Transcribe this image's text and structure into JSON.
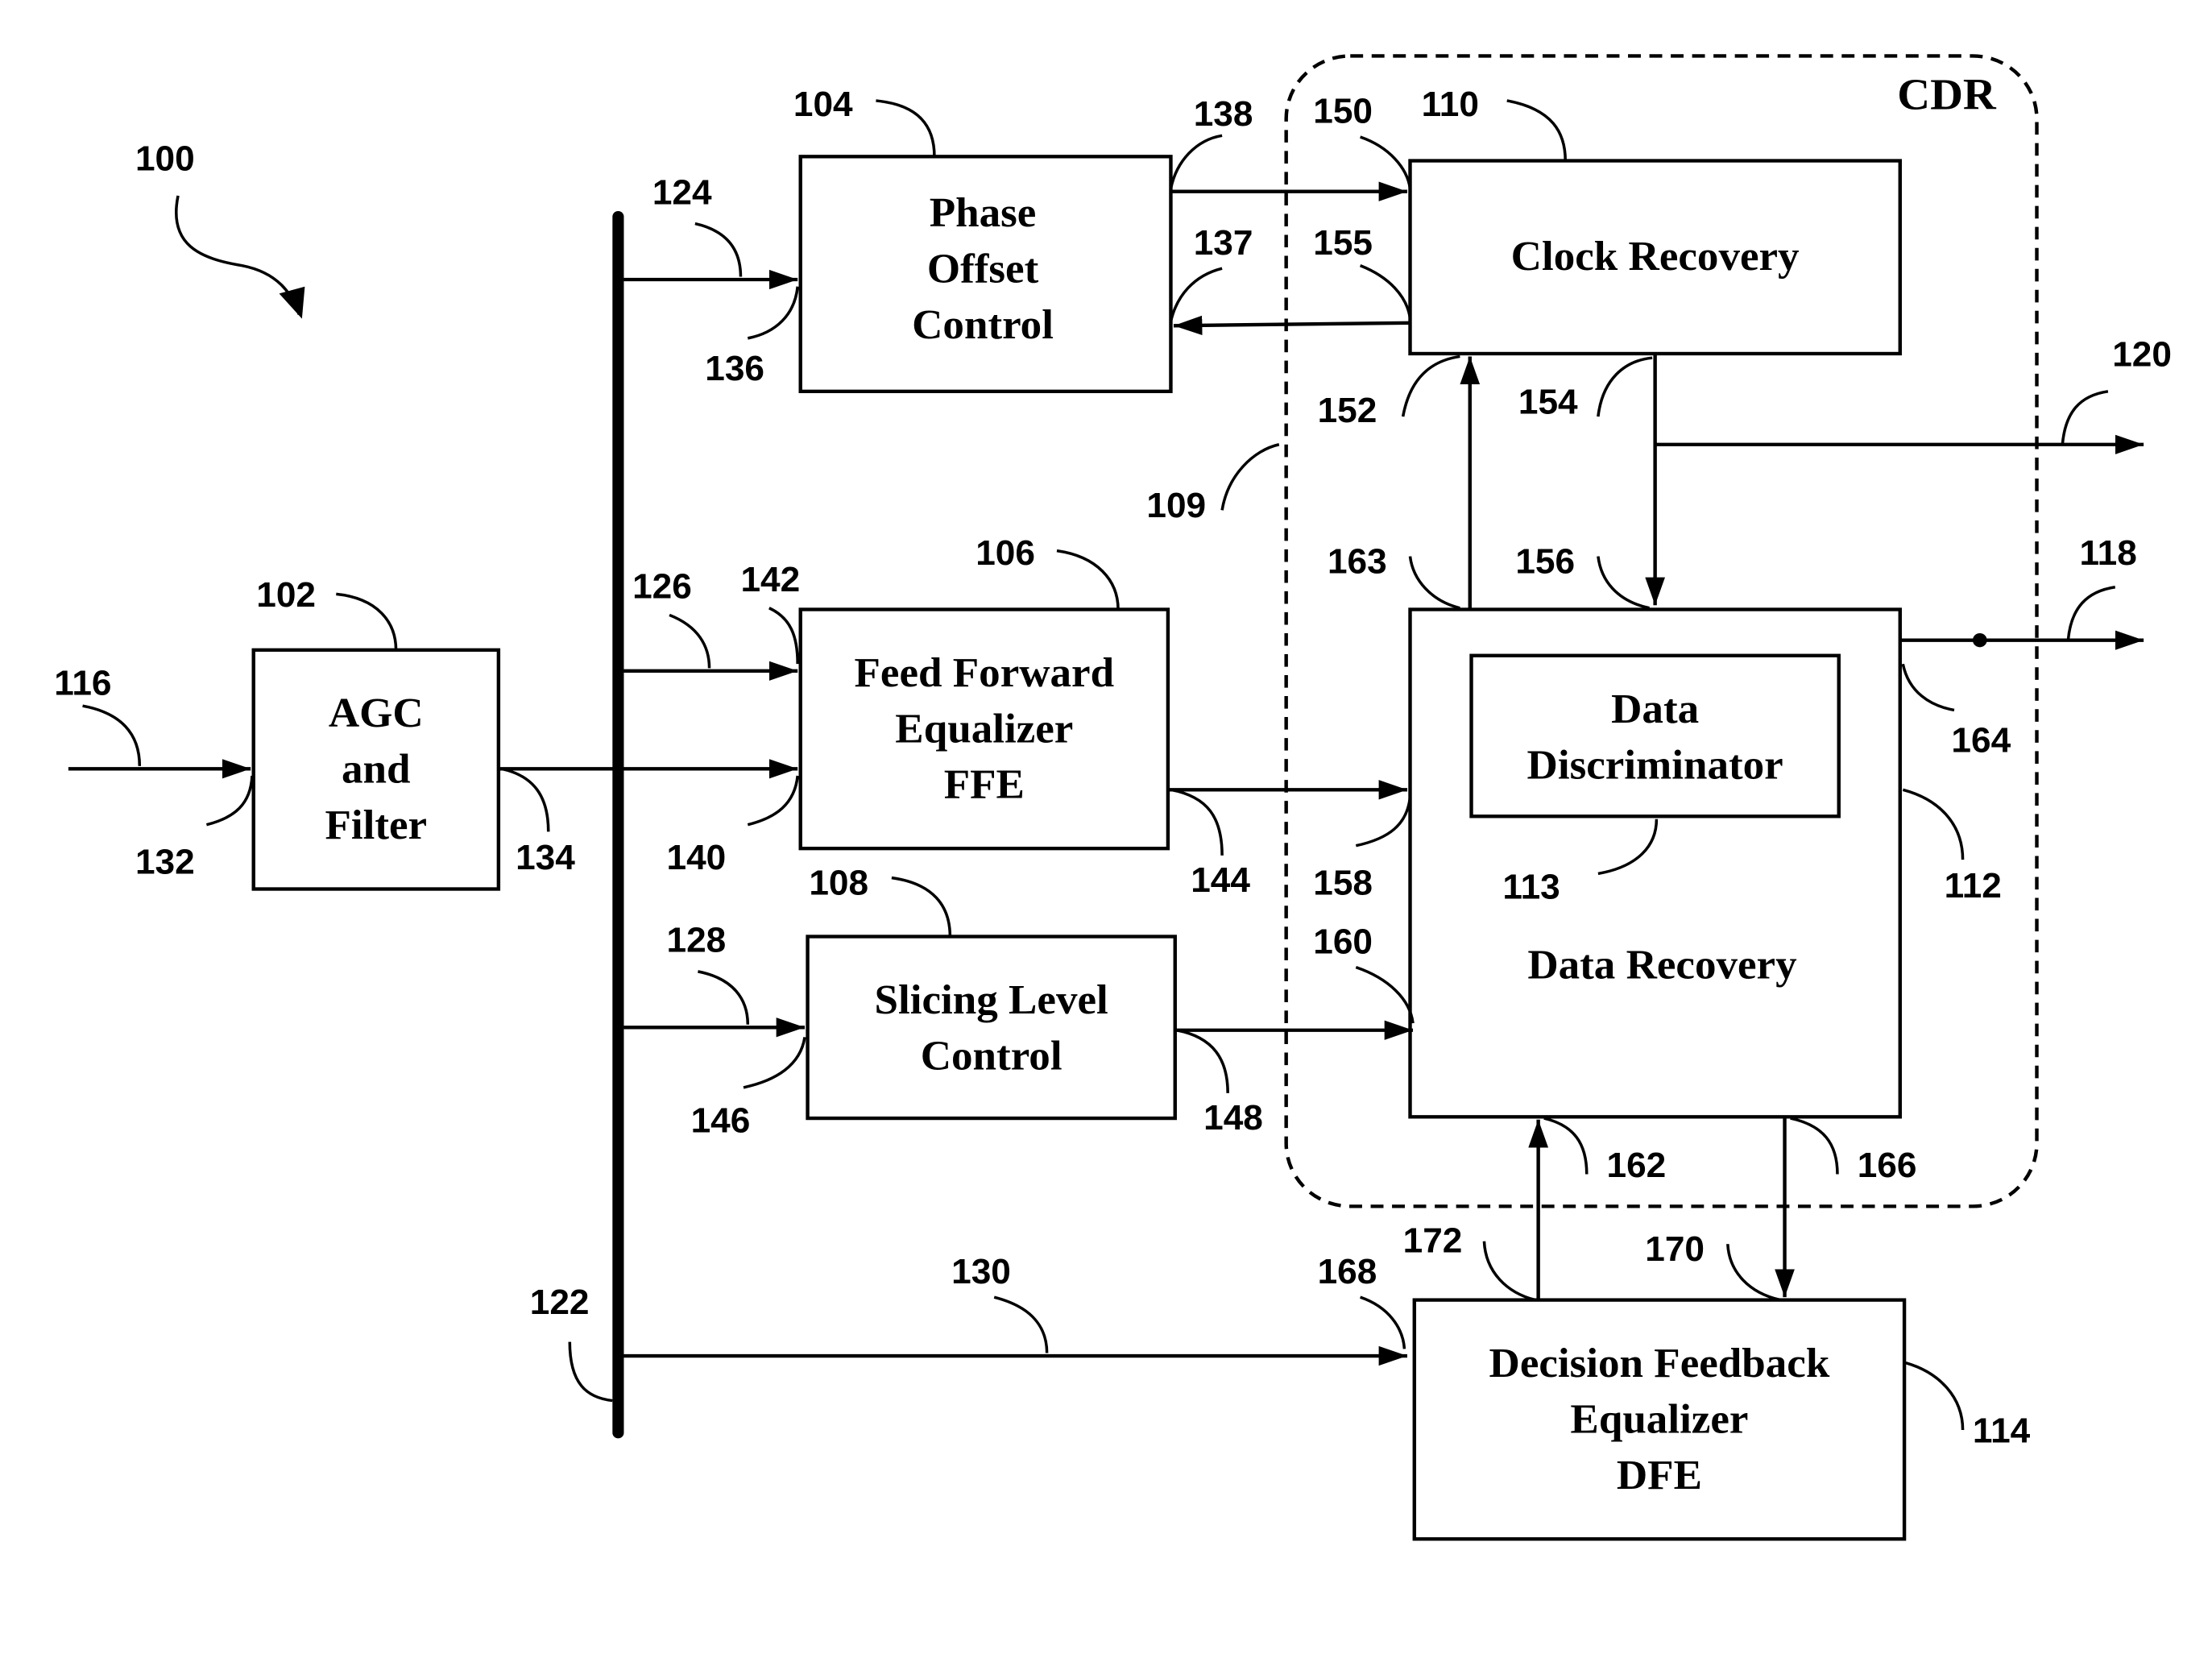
{
  "figure": {
    "ref": "100",
    "container_label": "CDR"
  },
  "blocks": {
    "agc": {
      "ref": "102",
      "lines": [
        "AGC",
        "and",
        "Filter"
      ]
    },
    "phase": {
      "ref": "104",
      "lines": [
        "Phase",
        "Offset",
        "Control"
      ]
    },
    "ffe": {
      "ref": "106",
      "lines": [
        "Feed Forward",
        "Equalizer",
        "FFE"
      ]
    },
    "slicing": {
      "ref": "108",
      "lines": [
        "Slicing Level",
        "Control"
      ]
    },
    "clock": {
      "ref": "110",
      "lines": [
        "Clock Recovery"
      ]
    },
    "data_recovery": {
      "ref": "112",
      "lines": [
        "Data Recovery"
      ]
    },
    "discriminator": {
      "ref": "113",
      "lines": [
        "Data",
        "Discriminator"
      ]
    },
    "dfe": {
      "ref": "114",
      "lines": [
        "Decision Feedback",
        "Equalizer",
        "DFE"
      ]
    },
    "cdr": {
      "ref": "109"
    }
  },
  "refs": {
    "r116": "116",
    "r118": "118",
    "r120": "120",
    "r122": "122",
    "r124": "124",
    "r126": "126",
    "r128": "128",
    "r130": "130",
    "r132": "132",
    "r134": "134",
    "r136": "136",
    "r137": "137",
    "r138": "138",
    "r140": "140",
    "r142": "142",
    "r144": "144",
    "r146": "146",
    "r148": "148",
    "r150": "150",
    "r152": "152",
    "r154": "154",
    "r155": "155",
    "r156": "156",
    "r158": "158",
    "r160": "160",
    "r162": "162",
    "r163": "163",
    "r164": "164",
    "r166": "166",
    "r168": "168",
    "r170": "170",
    "r172": "172"
  }
}
